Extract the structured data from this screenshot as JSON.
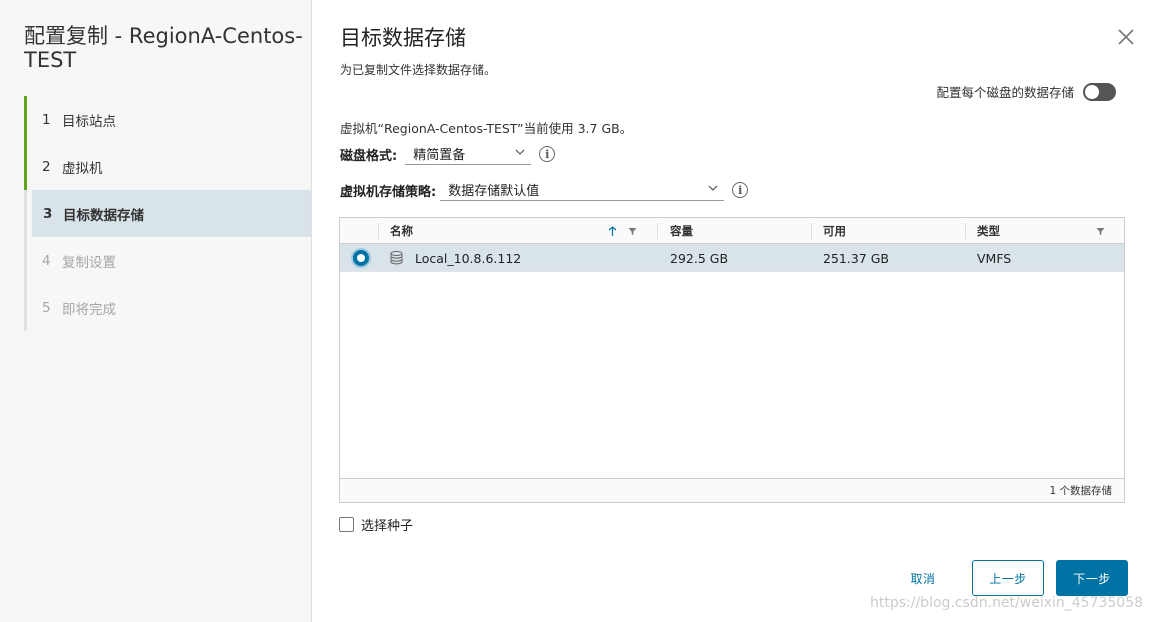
{
  "wizard": {
    "title": "配置复制 - RegionA-Centos-TEST",
    "steps": [
      {
        "num": "1",
        "label": "目标站点"
      },
      {
        "num": "2",
        "label": "虚拟机"
      },
      {
        "num": "3",
        "label": "目标数据存储"
      },
      {
        "num": "4",
        "label": "复制设置"
      },
      {
        "num": "5",
        "label": "即将完成"
      }
    ]
  },
  "page": {
    "title": "目标数据存储",
    "subtitle": "为已复制文件选择数据存储。",
    "per_disk_label": "配置每个磁盘的数据存储",
    "per_disk_toggle": "off",
    "vm_info": "虚拟机“RegionA-Centos-TEST”当前使用 3.7 GB。",
    "disk_format_label": "磁盘格式:",
    "disk_format_value": "精简置备",
    "policy_label": "虚拟机存储策略:",
    "policy_value": "数据存储默认值",
    "info_glyph": "i"
  },
  "table": {
    "columns": [
      "名称",
      "容量",
      "可用",
      "类型"
    ],
    "rows": [
      {
        "name": "Local_10.8.6.112",
        "capacity": "292.5 GB",
        "free": "251.37 GB",
        "type": "VMFS",
        "selected": true
      }
    ],
    "footer": "1 个数据存储"
  },
  "seed_label": "选择种子",
  "buttons": {
    "cancel": "取消",
    "back": "上一步",
    "next": "下一步"
  },
  "watermark": "https://blog.csdn.net/weixin_45735058",
  "colors": {
    "accent": "#0072a3",
    "step_done": "#62a420",
    "selected_row": "#d9e4ea"
  }
}
